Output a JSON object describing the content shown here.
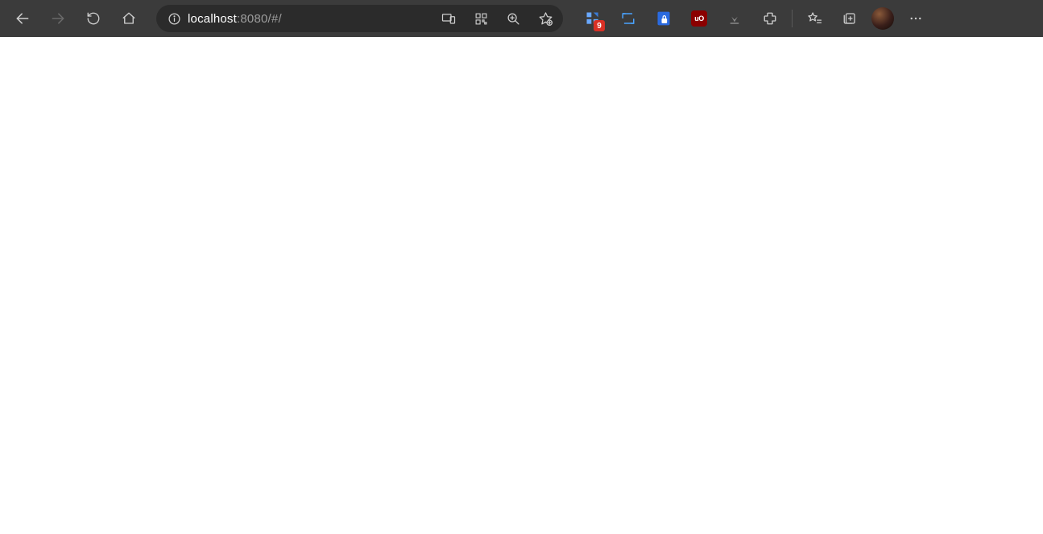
{
  "nav": {
    "back_enabled": true,
    "forward_enabled": false
  },
  "url": {
    "host": "localhost",
    "rest": ":8080/#/"
  },
  "extensions": {
    "react_devtools_badge": "9",
    "ublock_label": "uO"
  }
}
